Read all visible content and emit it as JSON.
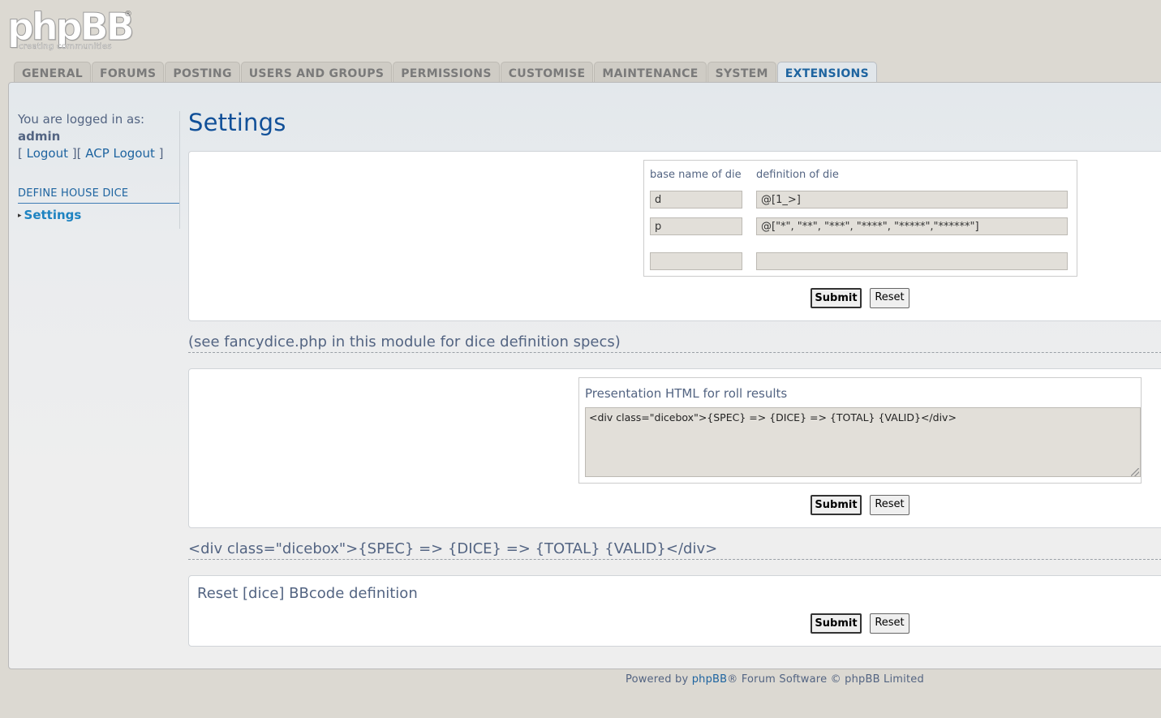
{
  "logo": {
    "text": "phpBB",
    "reg": "®",
    "tagline": "creating  communities"
  },
  "tabs": [
    {
      "label": "GENERAL"
    },
    {
      "label": "FORUMS"
    },
    {
      "label": "POSTING"
    },
    {
      "label": "USERS AND GROUPS"
    },
    {
      "label": "PERMISSIONS"
    },
    {
      "label": "CUSTOMISE"
    },
    {
      "label": "MAINTENANCE"
    },
    {
      "label": "SYSTEM"
    },
    {
      "label": "EXTENSIONS",
      "active": true
    }
  ],
  "menu": {
    "logged_in_as": "You are logged in as:",
    "username": "admin",
    "bracket_open": "[ ",
    "logout": "Logout",
    "bracket_mid": " ][ ",
    "acp_logout": "ACP Logout",
    "bracket_close": " ]",
    "category": "DEFINE HOUSE DICE",
    "item": "Settings"
  },
  "page_title": "Settings",
  "dice_form": {
    "col_name": "base name of die",
    "col_def": "definition of die",
    "rows": [
      {
        "name": "d",
        "definition": "@[1_>]"
      },
      {
        "name": "p",
        "definition": "@[\"*\", \"**\", \"***\", \"****\", \"*****\",\"******\"]"
      },
      {
        "name": "",
        "definition": ""
      }
    ],
    "submit": "Submit",
    "reset": "Reset"
  },
  "dice_note": "(see fancydice.php in this module for dice definition specs)",
  "presentation_form": {
    "label": "Presentation HTML for roll results",
    "value": "<div class=\"dicebox\">{SPEC} => {DICE} => {TOTAL} {VALID}</div>",
    "submit": "Submit",
    "reset": "Reset"
  },
  "presentation_note": "<div class=\"dicebox\">{SPEC} => {DICE} => {TOTAL} {VALID}</div>",
  "bbcode_form": {
    "label": "Reset [dice] BBcode definition",
    "submit": "Submit",
    "reset": "Reset"
  },
  "footer": {
    "powered_by": "Powered by ",
    "link": "phpBB",
    "rest": "® Forum Software © phpBB Limited"
  }
}
